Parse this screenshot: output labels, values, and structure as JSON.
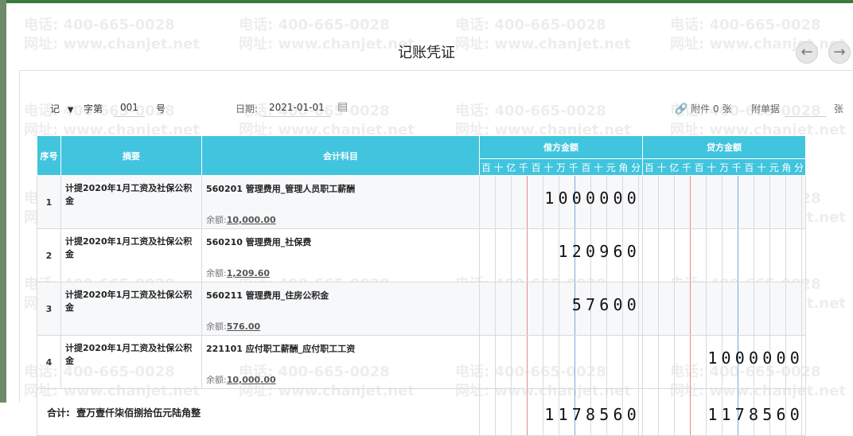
{
  "window": {
    "title": "记账凭证"
  },
  "watermark": {
    "phone": "电话: 400-665-0028",
    "site": "网址: www.chanjet.net"
  },
  "header": {
    "voucher_type": "记",
    "word_label": "字第",
    "number": "001",
    "number_suffix": "号",
    "date_label": "日期:",
    "date_value": "2021-01-01",
    "attachments_label": "附件 0 张",
    "documents_label": "附单据",
    "documents_suffix": "张"
  },
  "table": {
    "col_seq": "序号",
    "col_summary": "摘要",
    "col_subject": "会计科目",
    "col_debit": "借方金额",
    "col_credit": "贷方金额",
    "digits": [
      "百",
      "十",
      "亿",
      "千",
      "百",
      "十",
      "万",
      "千",
      "百",
      "十",
      "元",
      "角",
      "分"
    ],
    "balance_label": "余额:",
    "rows": [
      {
        "seq": "1",
        "summary": "计提2020年1月工资及社保公积金",
        "subject": "560201 管理费用_管理人员职工薪酬",
        "balance": "10,000.00",
        "debit": "1000000",
        "credit": ""
      },
      {
        "seq": "2",
        "summary": "计提2020年1月工资及社保公积金",
        "subject": "560210 管理费用_社保费",
        "balance": "1,209.60",
        "debit": "120960",
        "credit": ""
      },
      {
        "seq": "3",
        "summary": "计提2020年1月工资及社保公积金",
        "subject": "560211 管理费用_住房公积金",
        "balance": "576.00",
        "debit": "57600",
        "credit": ""
      },
      {
        "seq": "4",
        "summary": "计提2020年1月工资及社保公积金",
        "subject": "221101 应付职工薪酬_应付职工工资",
        "balance": "10,000.00",
        "debit": "",
        "credit": "1000000"
      }
    ],
    "total": {
      "label": "合计:",
      "amount_in_words": "壹万壹仟柒佰捌拾伍元陆角整",
      "debit": "1178560",
      "credit": "1178560"
    }
  },
  "colors": {
    "header_bg": "#41c4de",
    "yuan_line": "#e58c8c",
    "thousand_line": "#7aa8d8"
  }
}
